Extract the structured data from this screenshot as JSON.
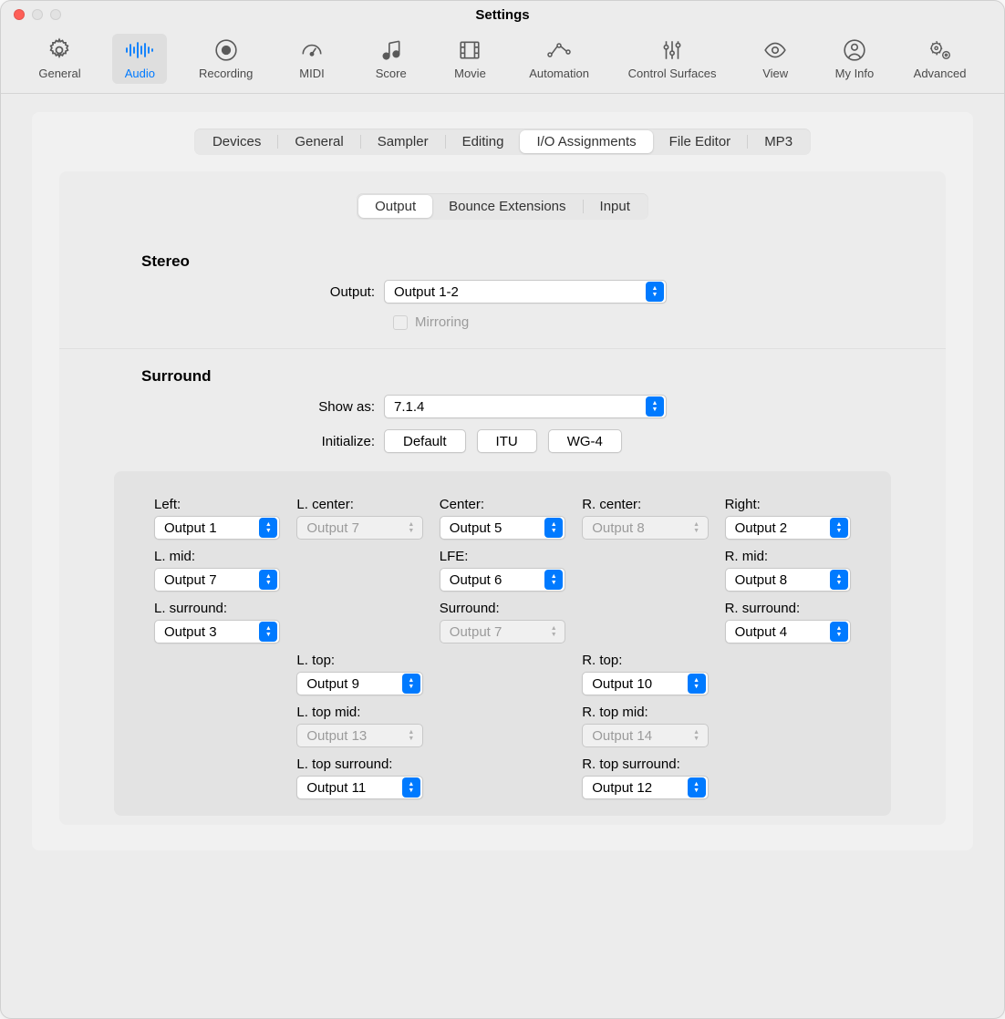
{
  "window": {
    "title": "Settings"
  },
  "toolbar": {
    "items": [
      {
        "label": "General"
      },
      {
        "label": "Audio"
      },
      {
        "label": "Recording"
      },
      {
        "label": "MIDI"
      },
      {
        "label": "Score"
      },
      {
        "label": "Movie"
      },
      {
        "label": "Automation"
      },
      {
        "label": "Control Surfaces"
      },
      {
        "label": "View"
      },
      {
        "label": "My Info"
      },
      {
        "label": "Advanced"
      }
    ],
    "active": "Audio"
  },
  "tabs1": {
    "items": [
      "Devices",
      "General",
      "Sampler",
      "Editing",
      "I/O Assignments",
      "File Editor",
      "MP3"
    ],
    "active": "I/O Assignments"
  },
  "tabs2": {
    "items": [
      "Output",
      "Bounce Extensions",
      "Input"
    ],
    "active": "Output"
  },
  "stereo": {
    "title": "Stereo",
    "output_label": "Output:",
    "output_value": "Output 1-2",
    "mirroring_label": "Mirroring"
  },
  "surround": {
    "title": "Surround",
    "showas_label": "Show as:",
    "showas_value": "7.1.4",
    "init_label": "Initialize:",
    "buttons": [
      "Default",
      "ITU",
      "WG-4"
    ]
  },
  "channels": {
    "r1": [
      {
        "label": "Left:",
        "value": "Output 1",
        "enabled": true
      },
      {
        "label": "L. center:",
        "value": "Output 7",
        "enabled": false
      },
      {
        "label": "Center:",
        "value": "Output 5",
        "enabled": true
      },
      {
        "label": "R. center:",
        "value": "Output 8",
        "enabled": false
      },
      {
        "label": "Right:",
        "value": "Output 2",
        "enabled": true
      }
    ],
    "r2": [
      {
        "label": "L. mid:",
        "value": "Output 7",
        "enabled": true
      },
      {
        "label": "",
        "value": "",
        "enabled": false
      },
      {
        "label": "LFE:",
        "value": "Output 6",
        "enabled": true
      },
      {
        "label": "",
        "value": "",
        "enabled": false
      },
      {
        "label": "R. mid:",
        "value": "Output 8",
        "enabled": true
      }
    ],
    "r3": [
      {
        "label": "L. surround:",
        "value": "Output 3",
        "enabled": true
      },
      {
        "label": "",
        "value": "",
        "enabled": false
      },
      {
        "label": "Surround:",
        "value": "Output 7",
        "enabled": false,
        "disabled_select": true
      },
      {
        "label": "",
        "value": "",
        "enabled": false
      },
      {
        "label": "R. surround:",
        "value": "Output 4",
        "enabled": true
      }
    ],
    "r4": [
      {
        "label": "L. top:",
        "value": "Output 9",
        "enabled": true
      },
      {
        "label": "R. top:",
        "value": "Output 10",
        "enabled": true
      }
    ],
    "r5": [
      {
        "label": "L. top mid:",
        "value": "Output 13",
        "enabled": false
      },
      {
        "label": "R. top mid:",
        "value": "Output 14",
        "enabled": false
      }
    ],
    "r6": [
      {
        "label": "L. top surround:",
        "value": "Output 11",
        "enabled": true
      },
      {
        "label": "R. top surround:",
        "value": "Output 12",
        "enabled": true
      }
    ]
  }
}
